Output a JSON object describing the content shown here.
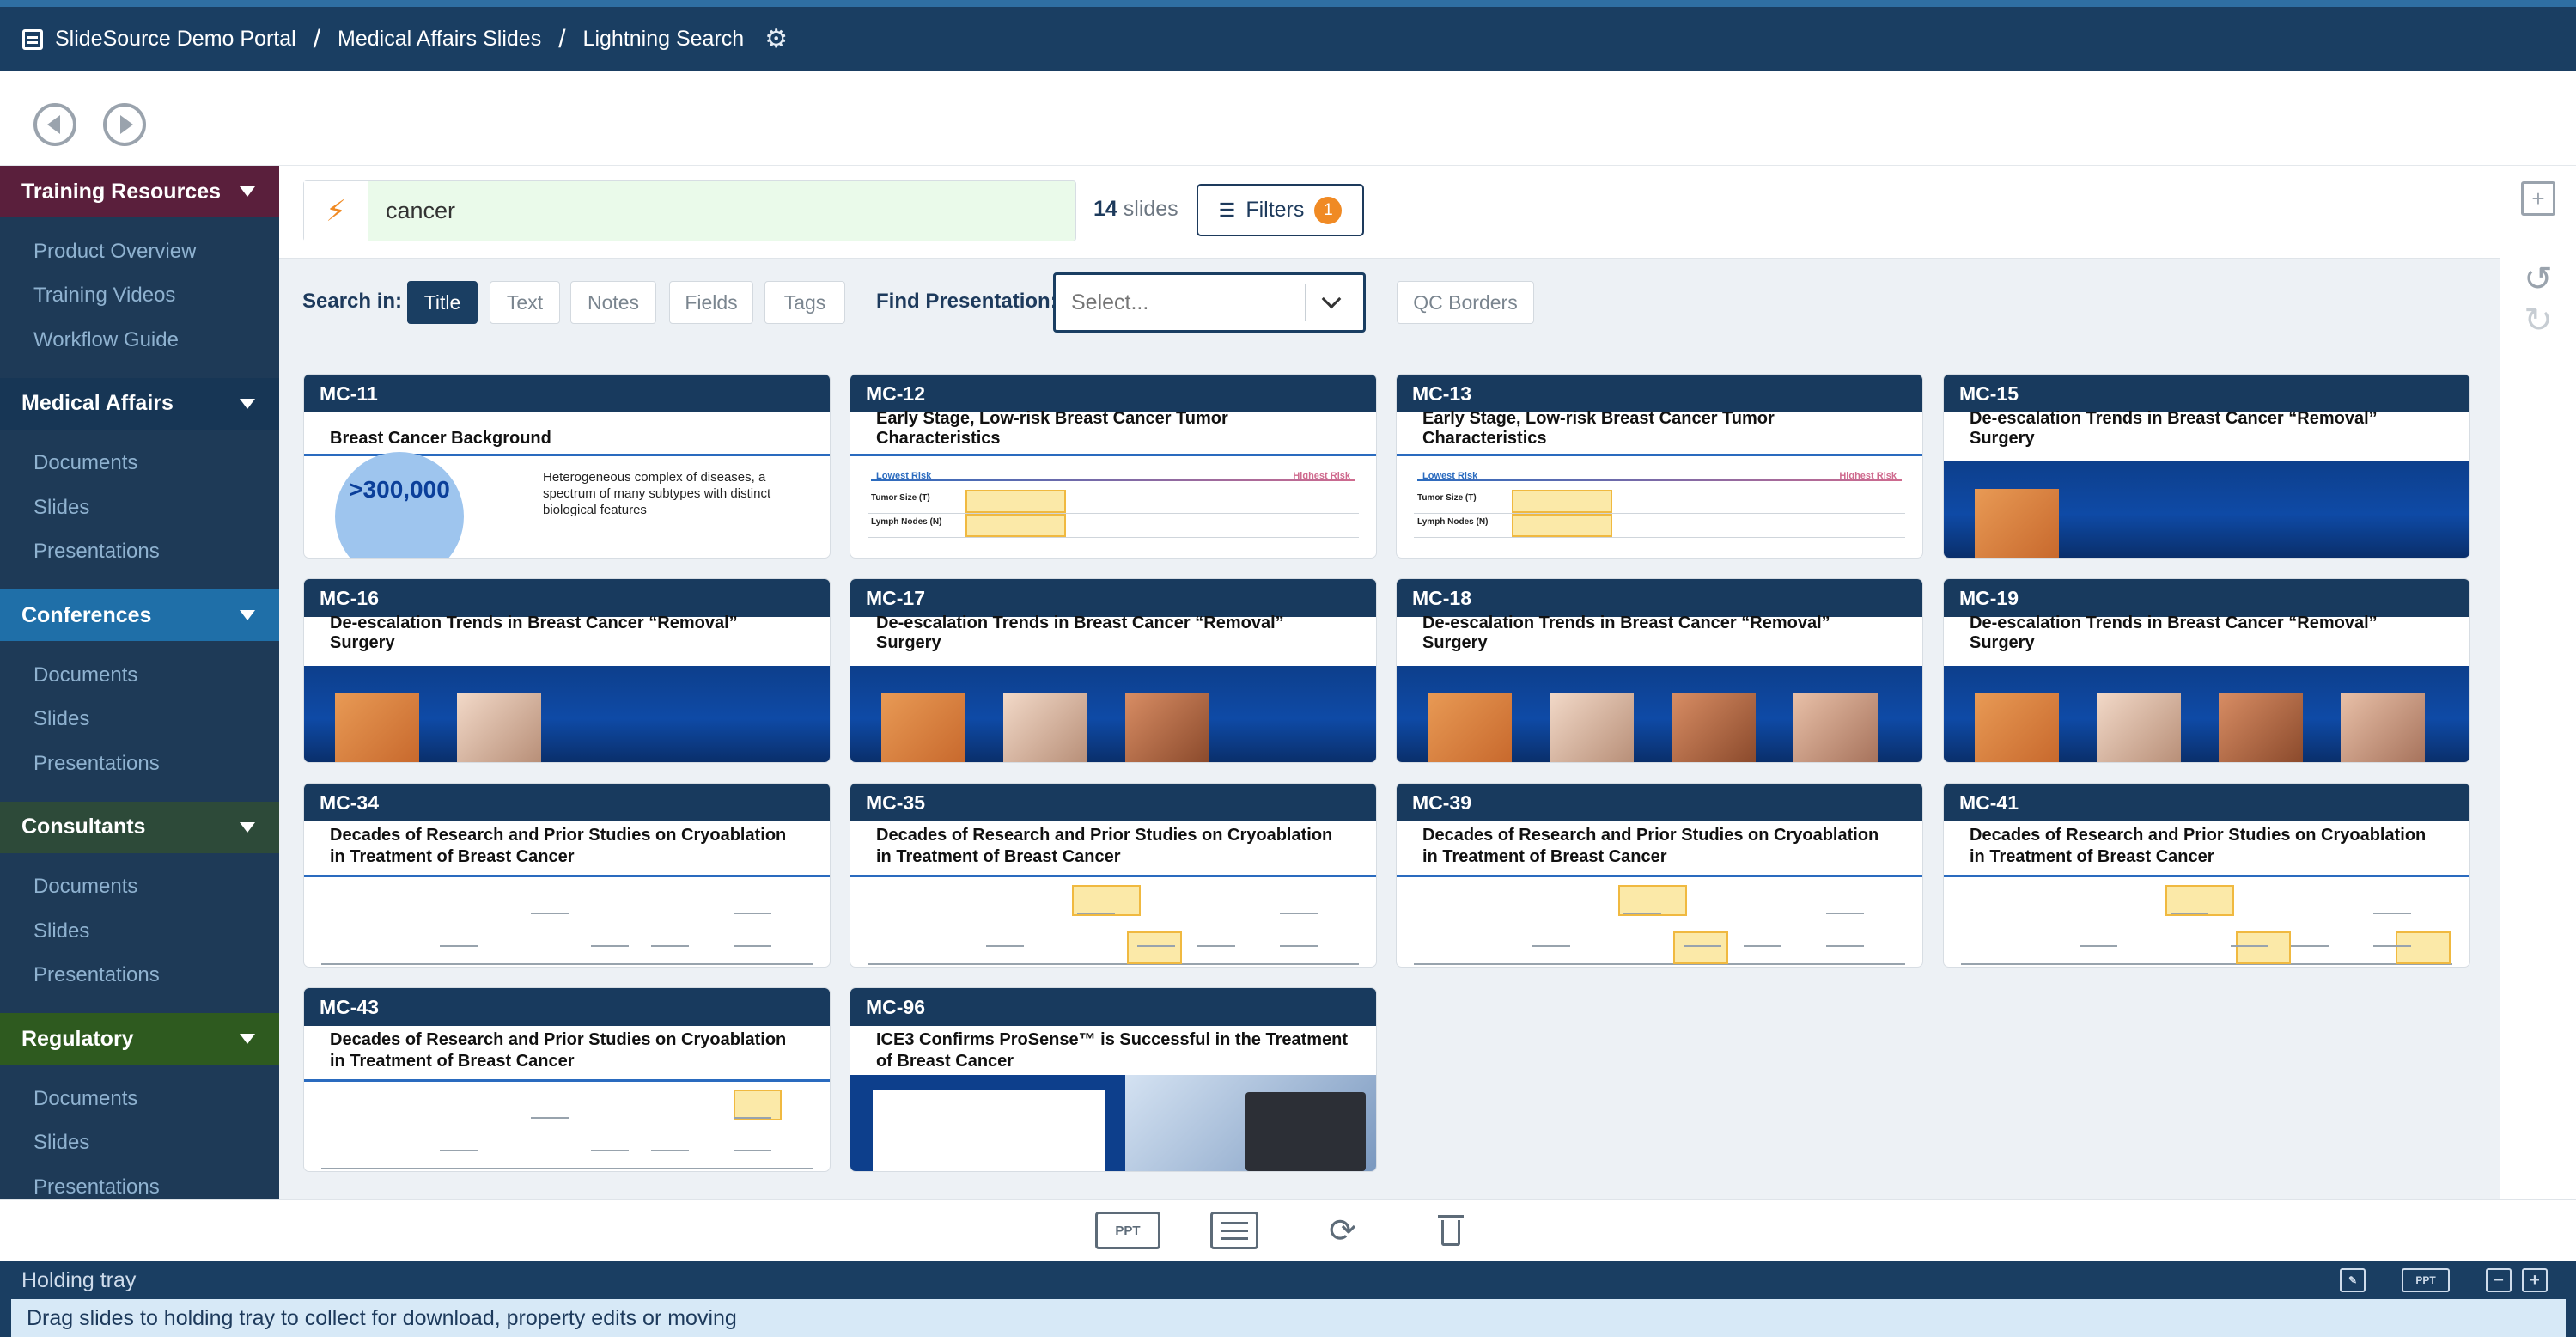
{
  "header": {
    "breadcrumbs": [
      "SlideSource Demo Portal",
      "Medical Affairs Slides",
      "Lightning Search"
    ],
    "separator": "/"
  },
  "sidebar": {
    "sections": [
      {
        "title": "Training Resources",
        "color": "#5a1f3c",
        "items": [
          "Product Overview",
          "Training Videos",
          "Workflow Guide"
        ]
      },
      {
        "title": "Medical Affairs",
        "color": "#173655",
        "items": [
          "Documents",
          "Slides",
          "Presentations"
        ]
      },
      {
        "title": "Conferences",
        "color": "#1f6fa8",
        "items": [
          "Documents",
          "Slides",
          "Presentations"
        ]
      },
      {
        "title": "Consultants",
        "color": "#2d4a39",
        "items": [
          "Documents",
          "Slides",
          "Presentations"
        ]
      },
      {
        "title": "Regulatory",
        "color": "#2e5a1f",
        "items": [
          "Documents",
          "Slides",
          "Presentations"
        ]
      }
    ]
  },
  "search": {
    "query": "cancer",
    "count_number": "14",
    "count_label": "slides",
    "filters_label": "Filters",
    "filters_badge": "1"
  },
  "options": {
    "search_in_label": "Search in:",
    "chips": [
      "Title",
      "Text",
      "Notes",
      "Fields",
      "Tags"
    ],
    "active_chip": "Title",
    "find_presentation_label": "Find Presentation:",
    "select_placeholder": "Select...",
    "qc_borders": "QC Borders"
  },
  "cards": [
    {
      "id": "MC-11",
      "title": "Breast Cancer Background",
      "type": "stat",
      "stat": ">300,000",
      "text": "Heterogeneous complex of diseases, a spectrum of many subtypes with distinct biological features"
    },
    {
      "id": "MC-12",
      "title": "Early Stage, Low-risk Breast Cancer Tumor Characteristics",
      "type": "risk"
    },
    {
      "id": "MC-13",
      "title": "Early Stage, Low-risk Breast Cancer Tumor Characteristics",
      "type": "risk"
    },
    {
      "id": "MC-15",
      "title": "De-escalation Trends in Breast Cancer “Removal” Surgery",
      "type": "photos1"
    },
    {
      "id": "MC-16",
      "title": "De-escalation Trends in Breast Cancer “Removal” Surgery",
      "type": "photos2"
    },
    {
      "id": "MC-17",
      "title": "De-escalation Trends in Breast Cancer “Removal” Surgery",
      "type": "photos3"
    },
    {
      "id": "MC-18",
      "title": "De-escalation Trends in Breast Cancer “Removal” Surgery",
      "type": "photos4"
    },
    {
      "id": "MC-19",
      "title": "De-escalation Trends in Breast Cancer “Removal” Surgery",
      "type": "photos4"
    },
    {
      "id": "MC-34",
      "title": "Decades of Research and Prior Studies on Cryoablation in Treatment of Breast Cancer",
      "type": "timeline"
    },
    {
      "id": "MC-35",
      "title": "Decades of Research and Prior Studies on Cryoablation in Treatment of Breast Cancer",
      "type": "timeline"
    },
    {
      "id": "MC-39",
      "title": "Decades of Research and Prior Studies on Cryoablation in Treatment of Breast Cancer",
      "type": "timeline"
    },
    {
      "id": "MC-41",
      "title": "Decades of Research and Prior Studies on Cryoablation in Treatment of Breast Cancer",
      "type": "timeline"
    },
    {
      "id": "MC-43",
      "title": "Decades of Research and Prior Studies on Cryoablation in Treatment of Breast Cancer",
      "type": "timeline"
    },
    {
      "id": "MC-96",
      "title": "ICE3 Confirms ProSense™ is Successful in the Treatment of Breast Cancer",
      "type": "ice"
    }
  ],
  "card_labels": {
    "lowest_risk": "Lowest Risk",
    "highest_risk": "Highest Risk",
    "tumor_size": "Tumor Size (T)",
    "lymph_nodes": "Lymph Nodes (N)"
  },
  "toolbar": {
    "ppt_label": "PPT"
  },
  "tray": {
    "title": "Holding tray",
    "message": "Drag slides to holding tray to collect for download, property edits or moving",
    "ppt_label": "PPT"
  },
  "icons": {
    "settings": "gear-icon",
    "back": "back-arrow-icon",
    "forward": "forward-arrow-icon",
    "search": "lightning-icon",
    "filters": "filter-icon",
    "download": "download-ppt-icon",
    "properties": "edit-list-icon",
    "sync": "sync-icon",
    "delete": "trash-icon"
  },
  "colors": {
    "header": "#1a3e62",
    "accent": "#f08a24",
    "search_bg": "#eafaea"
  }
}
